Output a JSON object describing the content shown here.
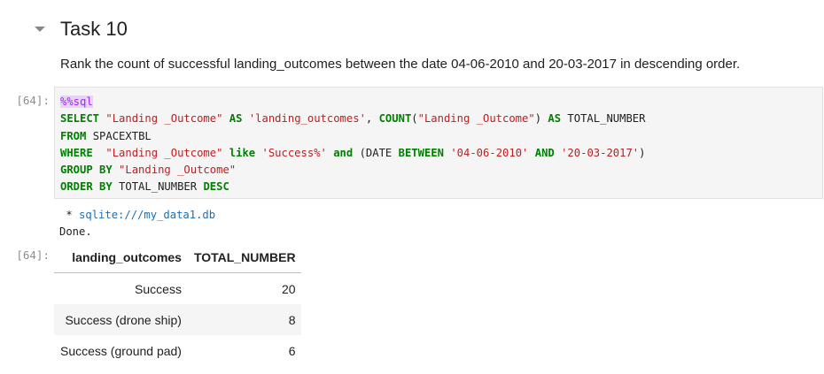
{
  "section": {
    "title": "Task 10",
    "description": "Rank the count of successful landing_outcomes between the date 04-06-2010 and 20-03-2017 in descending order."
  },
  "input_cell": {
    "prompt": "[64]:",
    "code": {
      "line1": {
        "magic": "%%sql"
      },
      "line2": {
        "kw1": "SELECT",
        "s1": "\"Landing _Outcome\"",
        "kw2": "AS",
        "s2": "'landing_outcomes'",
        "p1": ",",
        "kw3": "COUNT",
        "p2": "(",
        "s3": "\"Landing _Outcome\"",
        "p3": ")",
        "kw4": "AS",
        "n1": "TOTAL_NUMBER"
      },
      "line3": {
        "kw1": "FROM",
        "n1": "SPACEXTBL"
      },
      "line4": {
        "kw1": "WHERE",
        "s1": "\"Landing _Outcome\"",
        "kw2": "like",
        "s2": "'Success%'",
        "kw3": "and",
        "p1": "(DATE",
        "kw4": "BETWEEN",
        "s3": "'04-06-2010'",
        "kw5": "AND",
        "s4": "'20-03-2017'",
        "p2": ")"
      },
      "line5": {
        "kw1": "GROUP BY",
        "s1": "\"Landing _Outcome\""
      },
      "line6": {
        "kw1": "ORDER BY",
        "n1": "TOTAL_NUMBER",
        "kw2": "DESC"
      }
    }
  },
  "output": {
    "prompt": "[64]:",
    "bullet": " * ",
    "connection": "sqlite:///my_data1.db",
    "status": "Done.",
    "table": {
      "headers": [
        "landing_outcomes",
        "TOTAL_NUMBER"
      ],
      "rows": [
        [
          "Success",
          "20"
        ],
        [
          "Success (drone ship)",
          "8"
        ],
        [
          "Success (ground pad)",
          "6"
        ]
      ]
    }
  }
}
